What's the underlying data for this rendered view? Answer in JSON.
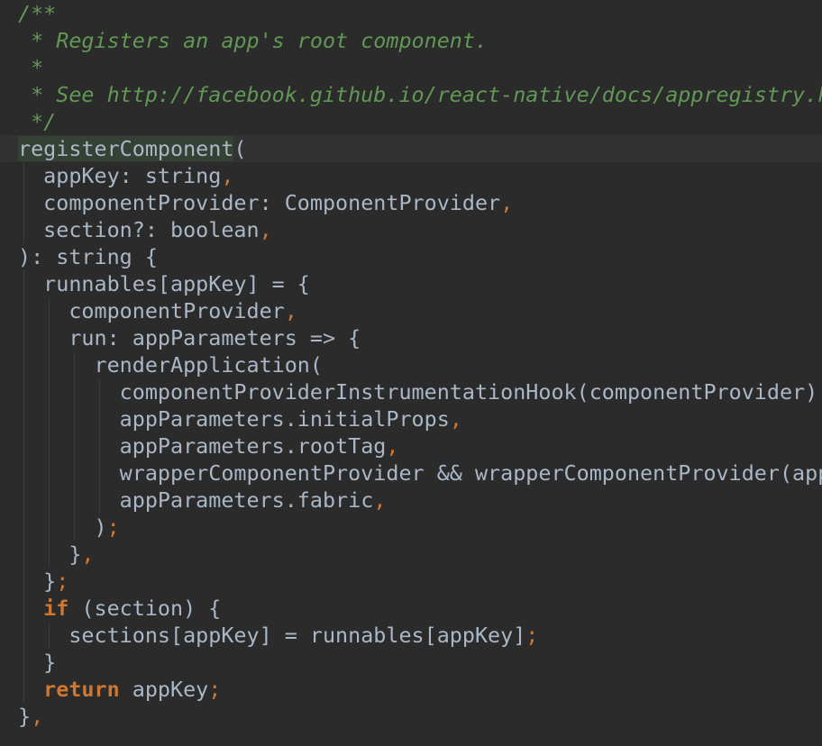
{
  "editor": {
    "lines": [
      {
        "tokens": [
          {
            "t": "comment",
            "v": "/**"
          }
        ]
      },
      {
        "tokens": [
          {
            "t": "comment",
            "v": " * Registers an app's root component."
          }
        ]
      },
      {
        "tokens": [
          {
            "t": "comment",
            "v": " *"
          }
        ]
      },
      {
        "tokens": [
          {
            "t": "comment",
            "v": " * See http://facebook.github.io/react-native/docs/appregistry.html#registercomponent"
          }
        ]
      },
      {
        "tokens": [
          {
            "t": "comment",
            "v": " */"
          }
        ]
      },
      {
        "current": true,
        "tokens": [
          {
            "t": "plain",
            "v": "registerComponent",
            "hl": true
          },
          {
            "t": "plain",
            "v": "("
          }
        ]
      },
      {
        "tokens": [
          {
            "t": "plain",
            "v": "  appKey: string"
          },
          {
            "t": "punct",
            "v": ","
          }
        ]
      },
      {
        "tokens": [
          {
            "t": "plain",
            "v": "  componentProvider: ComponentProvider"
          },
          {
            "t": "punct",
            "v": ","
          }
        ]
      },
      {
        "tokens": [
          {
            "t": "plain",
            "v": "  section?: boolean"
          },
          {
            "t": "punct",
            "v": ","
          }
        ]
      },
      {
        "tokens": [
          {
            "t": "plain",
            "v": "): string {"
          }
        ]
      },
      {
        "tokens": [
          {
            "t": "plain",
            "v": "  runnables[appKey] = {"
          }
        ]
      },
      {
        "tokens": [
          {
            "t": "plain",
            "v": "    componentProvider"
          },
          {
            "t": "punct",
            "v": ","
          }
        ]
      },
      {
        "tokens": [
          {
            "t": "plain",
            "v": "    run: appParameters => {"
          }
        ]
      },
      {
        "tokens": [
          {
            "t": "plain",
            "v": "      renderApplication("
          }
        ]
      },
      {
        "tokens": [
          {
            "t": "plain",
            "v": "        componentProviderInstrumentationHook(componentProvider)"
          },
          {
            "t": "punct",
            "v": ","
          }
        ]
      },
      {
        "tokens": [
          {
            "t": "plain",
            "v": "        appParameters.initialProps"
          },
          {
            "t": "punct",
            "v": ","
          }
        ]
      },
      {
        "tokens": [
          {
            "t": "plain",
            "v": "        appParameters.rootTag"
          },
          {
            "t": "punct",
            "v": ","
          }
        ]
      },
      {
        "tokens": [
          {
            "t": "plain",
            "v": "        wrapperComponentProvider && wrapperComponentProvider(appParameters)"
          },
          {
            "t": "punct",
            "v": ","
          }
        ]
      },
      {
        "tokens": [
          {
            "t": "plain",
            "v": "        appParameters.fabric"
          },
          {
            "t": "punct",
            "v": ","
          }
        ]
      },
      {
        "tokens": [
          {
            "t": "plain",
            "v": "      )"
          },
          {
            "t": "punct",
            "v": ";"
          }
        ]
      },
      {
        "tokens": [
          {
            "t": "plain",
            "v": "    }"
          },
          {
            "t": "punct",
            "v": ","
          }
        ]
      },
      {
        "tokens": [
          {
            "t": "plain",
            "v": "  }"
          },
          {
            "t": "punct",
            "v": ";"
          }
        ]
      },
      {
        "tokens": [
          {
            "t": "plain",
            "v": "  "
          },
          {
            "t": "keyword",
            "v": "if"
          },
          {
            "t": "plain",
            "v": " (section) {"
          }
        ]
      },
      {
        "tokens": [
          {
            "t": "plain",
            "v": "    sections[appKey] = runnables[appKey]"
          },
          {
            "t": "punct",
            "v": ";"
          }
        ]
      },
      {
        "tokens": [
          {
            "t": "plain",
            "v": "  }"
          }
        ]
      },
      {
        "tokens": [
          {
            "t": "plain",
            "v": "  "
          },
          {
            "t": "keyword",
            "v": "return"
          },
          {
            "t": "plain",
            "v": " appKey"
          },
          {
            "t": "punct",
            "v": ";"
          }
        ]
      },
      {
        "tokens": [
          {
            "t": "plain",
            "v": "}"
          },
          {
            "t": "punct",
            "v": ","
          }
        ]
      }
    ]
  },
  "theme": {
    "background": "#2b2b2b",
    "current_line": "#323232",
    "comment": "#629755",
    "keyword": "#cc7832",
    "text": "#a9b7c6",
    "method_highlight": "#344134"
  }
}
